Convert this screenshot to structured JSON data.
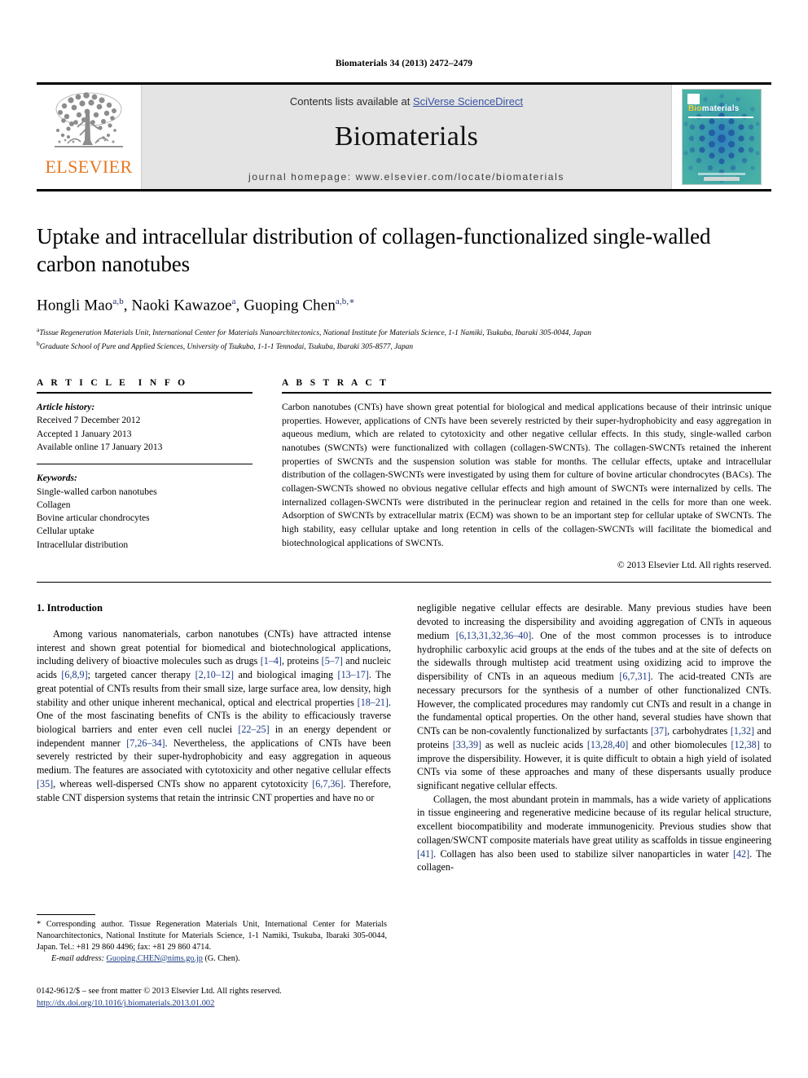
{
  "running_head": "Biomaterials 34 (2013) 2472–2479",
  "masthead": {
    "elsevier_wordmark": "ELSEVIER",
    "contents_prefix": "Contents lists available at ",
    "contents_link": "SciVerse ScienceDirect",
    "journal_name": "Biomaterials",
    "journal_homepage": "journal homepage: www.elsevier.com/locate/biomaterials",
    "cover_title_bio": "Bio",
    "cover_title_rest": "materials"
  },
  "article": {
    "title": "Uptake and intracellular distribution of collagen-functionalized single-walled carbon nanotubes",
    "authors": [
      {
        "name": "Hongli Mao",
        "sup": "a,b"
      },
      {
        "name": "Naoki Kawazoe",
        "sup": "a"
      },
      {
        "name": "Guoping Chen",
        "sup": "a,b,∗"
      }
    ],
    "affiliations": [
      {
        "marker": "a",
        "text": "Tissue Regeneration Materials Unit, International Center for Materials Nanoarchitectonics, National Institute for Materials Science, 1-1 Namiki, Tsukuba, Ibaraki 305-0044, Japan"
      },
      {
        "marker": "b",
        "text": "Graduate School of Pure and Applied Sciences, University of Tsukuba, 1-1-1 Tennodai, Tsukuba, Ibaraki 305-8577, Japan"
      }
    ]
  },
  "article_info": {
    "heading": "ARTICLE INFO",
    "history_label": "Article history:",
    "history": [
      "Received 7 December 2012",
      "Accepted 1 January 2013",
      "Available online 17 January 2013"
    ],
    "keywords_label": "Keywords:",
    "keywords": [
      "Single-walled carbon nanotubes",
      "Collagen",
      "Bovine articular chondrocytes",
      "Cellular uptake",
      "Intracellular distribution"
    ]
  },
  "abstract": {
    "heading": "ABSTRACT",
    "text": "Carbon nanotubes (CNTs) have shown great potential for biological and medical applications because of their intrinsic unique properties. However, applications of CNTs have been severely restricted by their super-hydrophobicity and easy aggregation in aqueous medium, which are related to cytotoxicity and other negative cellular effects. In this study, single-walled carbon nanotubes (SWCNTs) were functionalized with collagen (collagen-SWCNTs). The collagen-SWCNTs retained the inherent properties of SWCNTs and the suspension solution was stable for months. The cellular effects, uptake and intracellular distribution of the collagen-SWCNTs were investigated by using them for culture of bovine articular chondrocytes (BACs). The collagen-SWCNTs showed no obvious negative cellular effects and high amount of SWCNTs were internalized by cells. The internalized collagen-SWCNTs were distributed in the perinuclear region and retained in the cells for more than one week. Adsorption of SWCNTs by extracellular matrix (ECM) was shown to be an important step for cellular uptake of SWCNTs. The high stability, easy cellular uptake and long retention in cells of the collagen-SWCNTs will facilitate the biomedical and biotechnological applications of SWCNTs.",
    "copyright": "© 2013 Elsevier Ltd. All rights reserved."
  },
  "introduction": {
    "section_number_title": "1. Introduction",
    "left_column_paragraph": "Among various nanomaterials, carbon nanotubes (CNTs) have attracted intense interest and shown great potential for biomedical and biotechnological applications, including delivery of bioactive molecules such as drugs [1–4], proteins [5–7] and nucleic acids [6,8,9]; targeted cancer therapy [2,10–12] and biological imaging [13–17]. The great potential of CNTs results from their small size, large surface area, low density, high stability and other unique inherent mechanical, optical and electrical properties [18–21]. One of the most fascinating benefits of CNTs is the ability to efficaciously traverse biological barriers and enter even cell nuclei [22–25] in an energy dependent or independent manner [7,26–34]. Nevertheless, the applications of CNTs have been severely restricted by their super-hydrophobicity and easy aggregation in aqueous medium. The features are associated with cytotoxicity and other negative cellular effects [35], whereas well-dispersed CNTs show no apparent cytotoxicity [6,7,36]. Therefore, stable CNT dispersion systems that retain the intrinsic CNT properties and have no or",
    "right_column_paragraph_1": "negligible negative cellular effects are desirable. Many previous studies have been devoted to increasing the dispersibility and avoiding aggregation of CNTs in aqueous medium [6,13,31,32,36–40]. One of the most common processes is to introduce hydrophilic carboxylic acid groups at the ends of the tubes and at the site of defects on the sidewalls through multistep acid treatment using oxidizing acid to improve the dispersibility of CNTs in an aqueous medium [6,7,31]. The acid-treated CNTs are necessary precursors for the synthesis of a number of other functionalized CNTs. However, the complicated procedures may randomly cut CNTs and result in a change in the fundamental optical properties. On the other hand, several studies have shown that CNTs can be non-covalently functionalized by surfactants [37], carbohydrates [1,32] and proteins [33,39] as well as nucleic acids [13,28,40] and other biomolecules [12,38] to improve the dispersibility. However, it is quite difficult to obtain a high yield of isolated CNTs via some of these approaches and many of these dispersants usually produce significant negative cellular effects.",
    "right_column_paragraph_2": "Collagen, the most abundant protein in mammals, has a wide variety of applications in tissue engineering and regenerative medicine because of its regular helical structure, excellent biocompatibility and moderate immunogenicity. Previous studies show that collagen/SWCNT composite materials have great utility as scaffolds in tissue engineering [41]. Collagen has also been used to stabilize silver nanoparticles in water [42]. The collagen-"
  },
  "footnote": {
    "corresponding": "* Corresponding author. Tissue Regeneration Materials Unit, International Center for Materials Nanoarchitectonics, National Institute for Materials Science, 1-1 Namiki, Tsukuba, Ibaraki 305-0044, Japan. Tel.: +81 29 860 4496; fax: +81 29 860 4714.",
    "email_label": "E-mail address:",
    "email": "Guoping.CHEN@nims.go.jp",
    "email_suffix": "(G. Chen)."
  },
  "imprint": {
    "line1": "0142-9612/$ – see front matter © 2013 Elsevier Ltd. All rights reserved.",
    "doi": "http://dx.doi.org/10.1016/j.biomaterials.2013.01.002"
  },
  "colors": {
    "link": "#3a53a4",
    "reference": "#1c3a82",
    "elsevier_orange": "#E87722",
    "band_gray": "#e4e4e4",
    "cover_teal": "#3fa8a0"
  }
}
